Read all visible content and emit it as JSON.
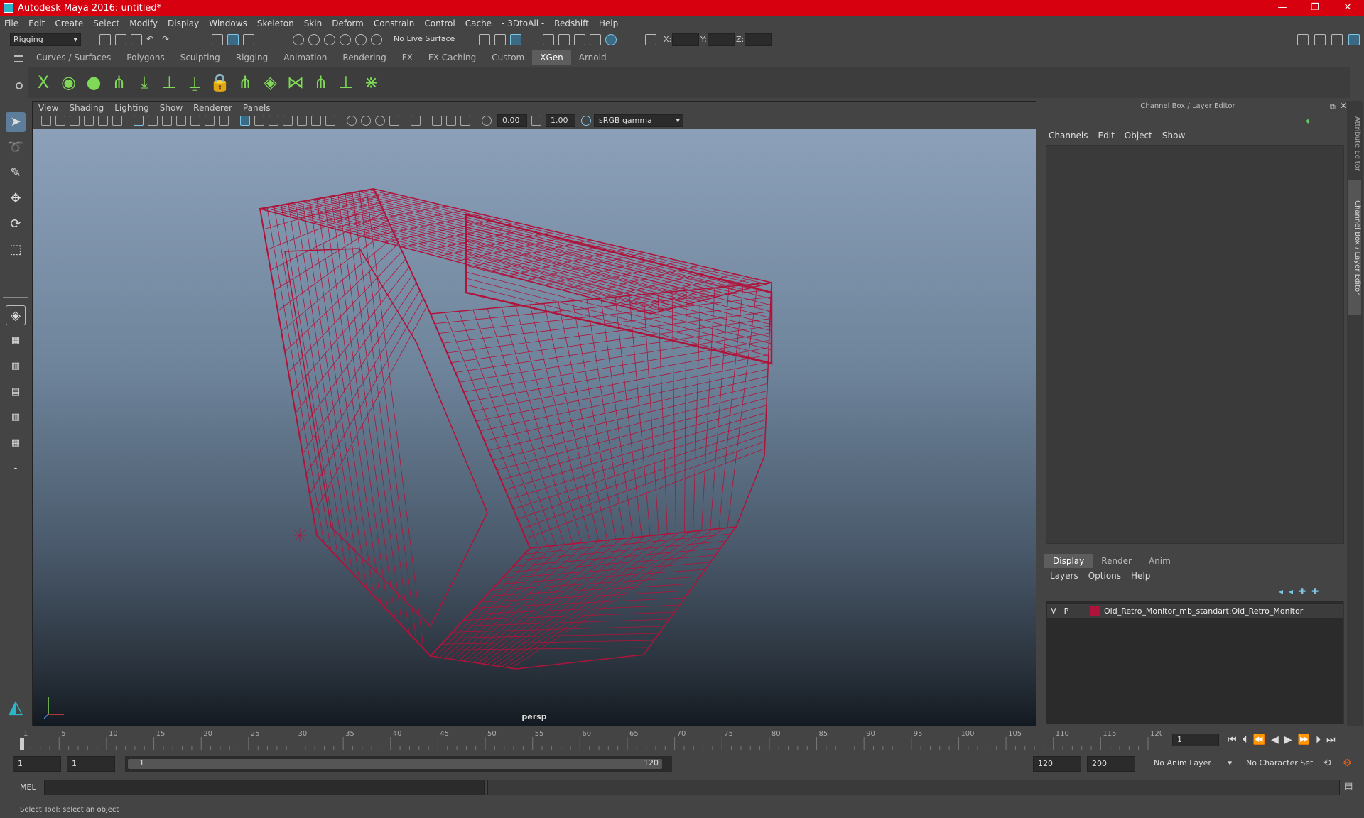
{
  "window": {
    "title": "Autodesk Maya 2016: untitled*",
    "minimize": "—",
    "restore": "❐",
    "close": "✕"
  },
  "menus": [
    "File",
    "Edit",
    "Create",
    "Select",
    "Modify",
    "Display",
    "Windows",
    "Skeleton",
    "Skin",
    "Deform",
    "Constrain",
    "Control",
    "Cache",
    "- 3DtoAll -",
    "Redshift",
    "Help"
  ],
  "toolbar": {
    "mode": "Rigging",
    "live_surface": "No Live Surface",
    "x_label": "X:",
    "y_label": "Y:",
    "z_label": "Z:"
  },
  "shelf_tabs": [
    "Curves / Surfaces",
    "Polygons",
    "Sculpting",
    "Rigging",
    "Animation",
    "Rendering",
    "FX",
    "FX Caching",
    "Custom",
    "XGen",
    "Arnold"
  ],
  "shelf_active": "XGen",
  "panel_menu": [
    "View",
    "Shading",
    "Lighting",
    "Show",
    "Renderer",
    "Panels"
  ],
  "panel_toolbar": {
    "exposure": "0.00",
    "gamma": "1.00",
    "color_space": "sRGB gamma"
  },
  "viewport": {
    "camera": "persp",
    "wire_color": "#b0133a"
  },
  "channel_box": {
    "title": "Channel Box / Layer Editor",
    "menu": [
      "Channels",
      "Edit",
      "Object",
      "Show"
    ]
  },
  "layer_editor": {
    "tabs": [
      "Display",
      "Render",
      "Anim"
    ],
    "active_tab": "Display",
    "menu": [
      "Layers",
      "Options",
      "Help"
    ],
    "layers": [
      {
        "v": "V",
        "p": "P",
        "name": "Old_Retro_Monitor_mb_standart:Old_Retro_Monitor",
        "color": "#b0133a"
      }
    ]
  },
  "side_tabs": [
    "Attribute Editor",
    "Channel Box / Layer Editor"
  ],
  "timeline": {
    "ticks": [
      "1",
      "5",
      "10",
      "15",
      "20",
      "25",
      "30",
      "35",
      "40",
      "45",
      "50",
      "55",
      "60",
      "65",
      "70",
      "75",
      "80",
      "85",
      "90",
      "95",
      "100",
      "105",
      "110",
      "115",
      "120"
    ],
    "current_frame": "1"
  },
  "range": {
    "start": "1",
    "playback_start": "1",
    "slider_start": "1",
    "slider_end": "120",
    "playback_end": "120",
    "end": "200",
    "anim_layer": "No Anim Layer",
    "char_set": "No Character Set"
  },
  "command_line": {
    "label": "MEL"
  },
  "status": "Select Tool: select an object"
}
